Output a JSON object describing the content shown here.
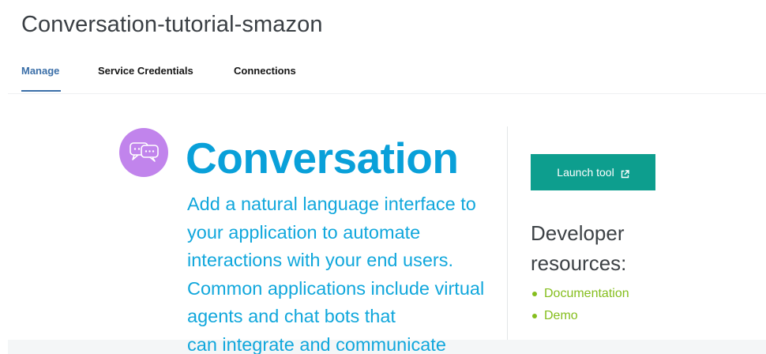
{
  "header": {
    "title": "Conversation-tutorial-smazon"
  },
  "tabs": [
    {
      "label": "Manage",
      "active": true
    },
    {
      "label": "Service Credentials",
      "active": false
    },
    {
      "label": "Connections",
      "active": false
    }
  ],
  "service": {
    "icon": "chat-bubbles-icon",
    "icon_color": "#c184ec",
    "name": "Conversation",
    "description": "Add a natural language interface to your application to automate interactions with your end users. Common applications include virtual agents and chat bots that",
    "description_cut_line": "can integrate and communicate"
  },
  "sidebar": {
    "launch_button": {
      "label": "Launch tool",
      "icon": "external-link-icon"
    },
    "resources_title": "Developer resources:",
    "resources": [
      {
        "label": "Documentation"
      },
      {
        "label": "Demo"
      }
    ]
  },
  "colors": {
    "accent_blue": "#3b6fa8",
    "brand_cyan": "#09a0d9",
    "launch_teal": "#0d9e8e",
    "link_green": "#85be1d"
  }
}
